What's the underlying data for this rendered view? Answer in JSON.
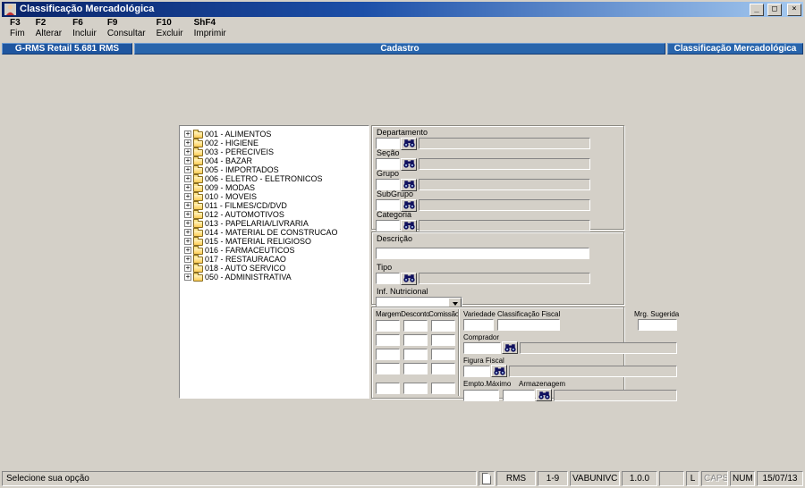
{
  "window": {
    "title": "Classificação Mercadológica",
    "controls": {
      "minimize": "_",
      "restore": "□",
      "close": "×"
    }
  },
  "toolbar": {
    "buttons": [
      {
        "key": "F3",
        "label": "Fim"
      },
      {
        "key": "F2",
        "label": "Alterar"
      },
      {
        "key": "F6",
        "label": "Incluir"
      },
      {
        "key": "F9",
        "label": "Consultar"
      },
      {
        "key": "F10",
        "label": "Excluir"
      },
      {
        "key": "ShF4",
        "label": "Imprimir"
      }
    ]
  },
  "header": {
    "left": "G-RMS Retail 5.681 RMS",
    "center": "Cadastro",
    "right": "Classificação Mercadológica"
  },
  "tree": {
    "expand_glyph": "+",
    "items": [
      "001 - ALIMENTOS",
      "002 - HIGIENE",
      "003 - PERECIVEIS",
      "004 - BAZAR",
      "005 - IMPORTADOS",
      "006 - ELETRO - ELETRONICOS",
      "009 - MODAS",
      "010 - MOVEIS",
      "011 - FILMES/CD/DVD",
      "012 - AUTOMOTIVOS",
      "013 - PAPELARIA/LIVRARIA",
      "014 - MATERIAL DE CONSTRUCAO",
      "015 - MATERIAL RELIGIOSO",
      "016 - FARMACEUTICOS",
      "017 - RESTAURACAO",
      "018 - AUTO SERVICO",
      "050 - ADMINISTRATIVA"
    ]
  },
  "form": {
    "lookup_fields": [
      {
        "label": "Departamento"
      },
      {
        "label": "Seção"
      },
      {
        "label": "Grupo"
      },
      {
        "label": "SubGrupo"
      },
      {
        "label": "Categoria"
      }
    ],
    "descricao_label": "Descrição",
    "tipo_label": "Tipo",
    "inf_nutricional_label": "Inf. Nutricional",
    "margins": {
      "columns": [
        "Margem",
        "Desconto",
        "Comissão"
      ]
    },
    "variedade_label": "Variedade",
    "classificacao_fiscal_label": "Classificação Fiscal",
    "mrg_sugerida_label": "Mrg. Sugerida",
    "comprador_label": "Comprador",
    "figura_fiscal_label": "Figura Fiscal",
    "empto_maximo_label": "Empto.Máximo",
    "armazenagem_label": "Armazenagem"
  },
  "statusbar": {
    "message": "Selecione sua opção",
    "system": "RMS",
    "range": "1-9",
    "user": "VABUNIVC",
    "version": "1.0.0",
    "l_indicator": "L",
    "caps_indicator": "CAPS",
    "num_indicator": "NUM",
    "date": "15/07/13"
  }
}
